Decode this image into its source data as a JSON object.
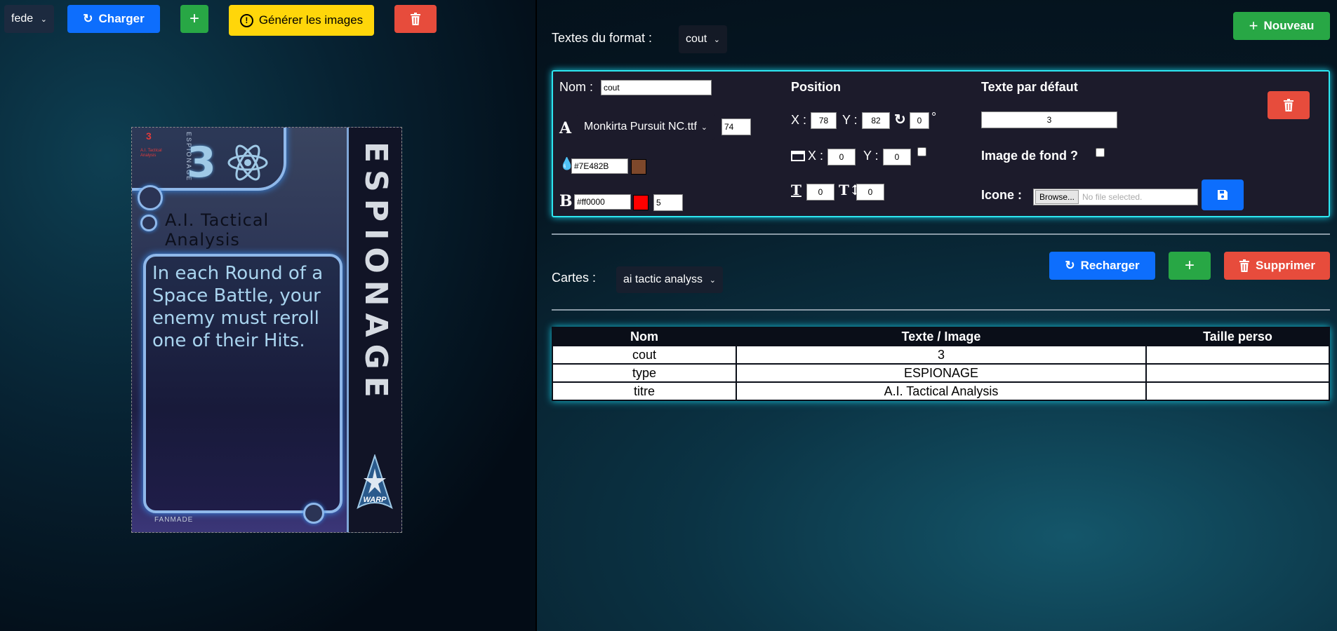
{
  "toolbar": {
    "set_select": "fede",
    "load_label": "Charger",
    "add_label": "+",
    "generate_label": "Générer les images"
  },
  "card": {
    "cost": "3",
    "mini_cost": "3",
    "mini_label": "A.I. Tactical Analysis",
    "vertical_small": "ESPIONAGE",
    "title": "A.I. Tactical Analysis",
    "text": "In each Round of a Space Battle, your enemy must reroll one of their Hits.",
    "fanmade": "FANMADE",
    "type": "ESPIONAGE",
    "logo_text": "WARP"
  },
  "format": {
    "label": "Textes du format :",
    "select": "cout",
    "new_label": "Nouveau"
  },
  "editor": {
    "name_label": "Nom :",
    "name_value": "cout",
    "font_value": "Monkirta Pursuit NC.ttf",
    "font_size": "74",
    "color_value": "#7E482B",
    "color_swatch": "#7E482B",
    "border_color_value": "#ff0000",
    "border_swatch": "#ff0000",
    "border_size": "5",
    "position_label": "Position",
    "x_label": "X :",
    "x_value": "78",
    "y_label": "Y :",
    "y_value": "82",
    "rotation_value": "0",
    "degree": "°",
    "box_x_label": "X :",
    "box_x_value": "0",
    "box_y_label": "Y :",
    "box_y_value": "0",
    "text_a_value": "0",
    "text_b_value": "0",
    "default_text_label": "Texte par défaut",
    "default_text_value": "3",
    "bg_image_label": "Image de fond ?",
    "icon_label": "Icone :",
    "browse_label": "Browse...",
    "file_placeholder": "No file selected."
  },
  "cards_section": {
    "label": "Cartes :",
    "select": "ai tactic analyss",
    "reload_label": "Recharger",
    "add_label": "+",
    "delete_label": "Supprimer"
  },
  "table": {
    "headers": [
      "Nom",
      "Texte / Image",
      "Taille perso"
    ],
    "rows": [
      [
        "cout",
        "3",
        ""
      ],
      [
        "type",
        "ESPIONAGE",
        ""
      ],
      [
        "titre",
        "A.I. Tactical Analysis",
        ""
      ]
    ]
  }
}
